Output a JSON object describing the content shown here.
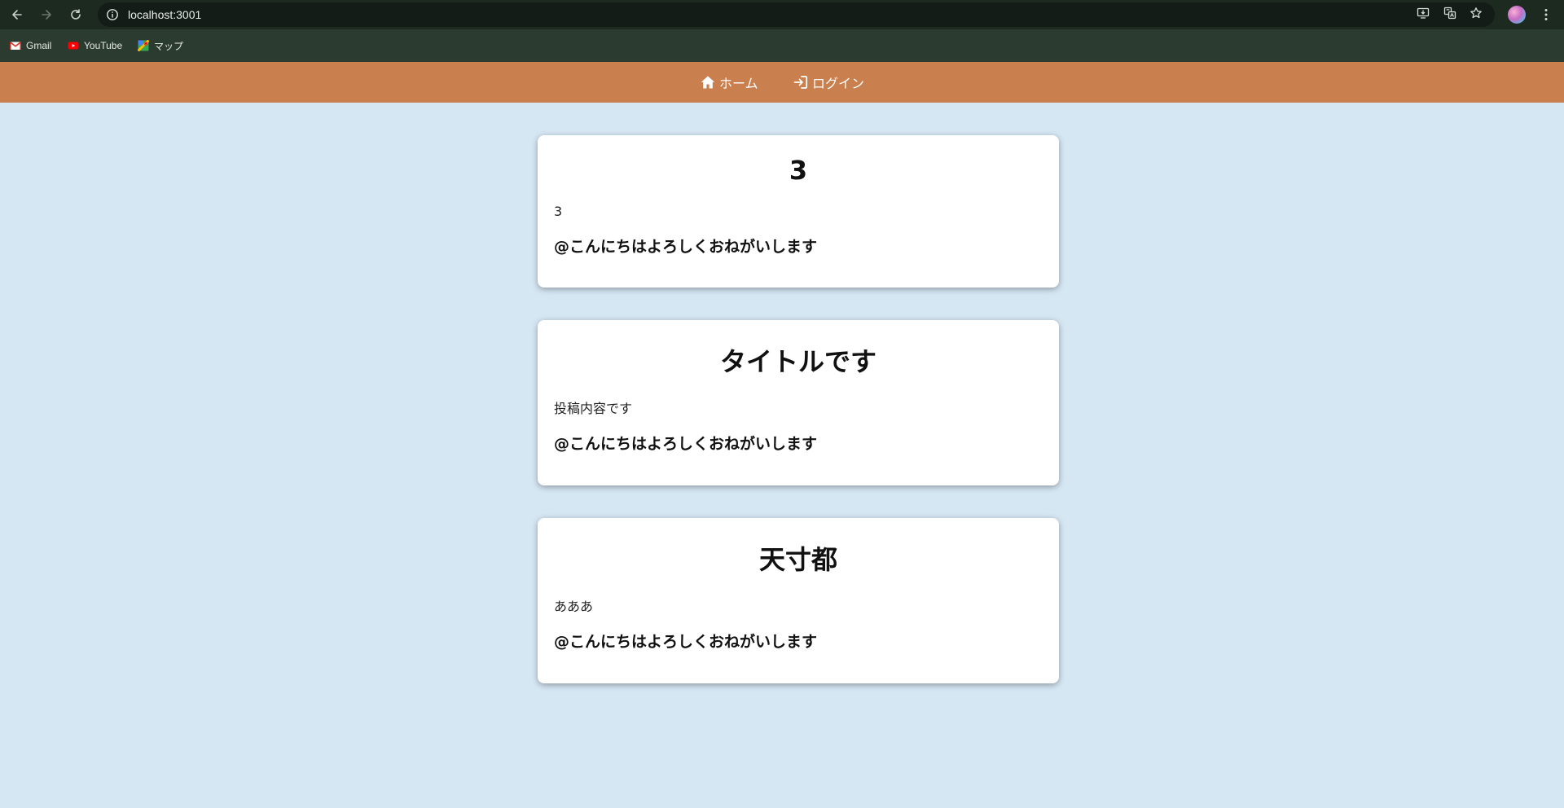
{
  "browser": {
    "url": "localhost:3001",
    "bookmarks": [
      {
        "label": "Gmail",
        "icon": "gmail-icon"
      },
      {
        "label": "YouTube",
        "icon": "youtube-icon"
      },
      {
        "label": "マップ",
        "icon": "maps-icon"
      }
    ]
  },
  "header": {
    "home_label": "ホーム",
    "login_label": "ログイン",
    "color": "#c97f4e"
  },
  "posts": [
    {
      "title": "3",
      "content": "3",
      "author": "@こんにちはよろしくおねがいします"
    },
    {
      "title": "タイトルです",
      "content": "投稿内容です",
      "author": "@こんにちはよろしくおねがいします"
    },
    {
      "title": "天寸都",
      "content": "あああ",
      "author": "@こんにちはよろしくおねがいします"
    }
  ],
  "colors": {
    "page_background": "#d6e7f4",
    "card_background": "#ffffff",
    "chrome_background": "#1c2a20"
  }
}
